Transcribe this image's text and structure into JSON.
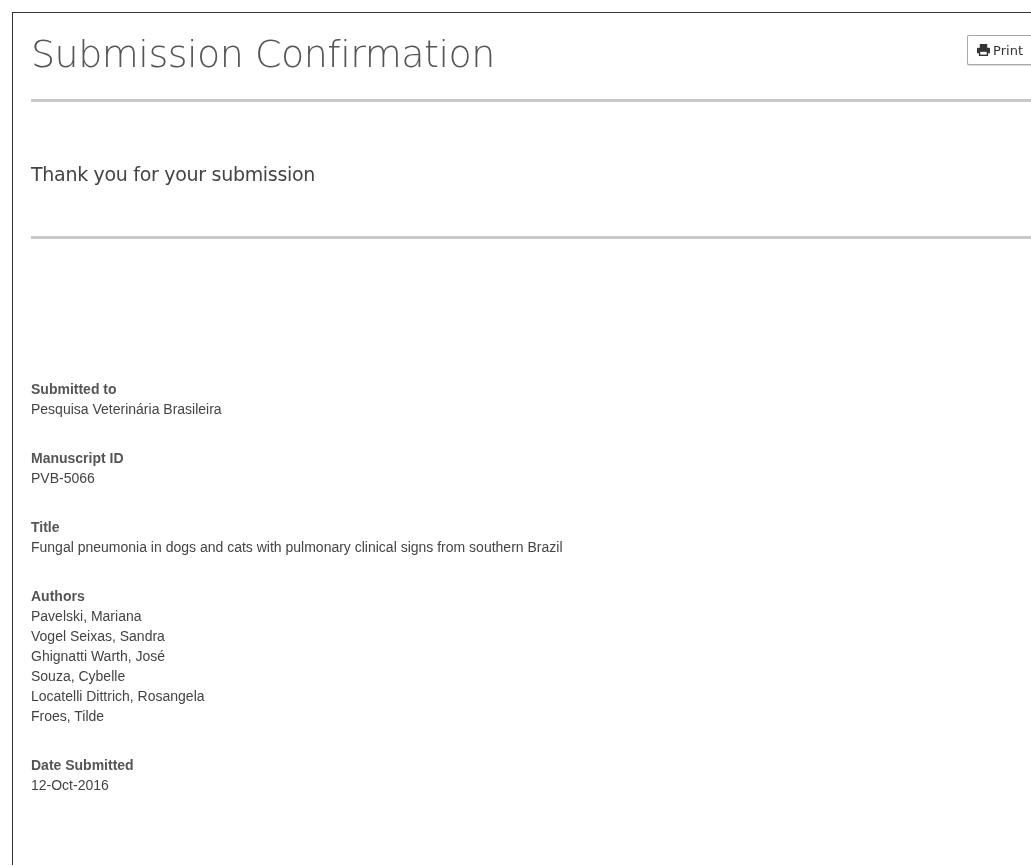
{
  "header": {
    "title": "Submission Confirmation",
    "print_button": "Print"
  },
  "message": "Thank you for your submission",
  "fields": [
    {
      "label": "Submitted to",
      "values": [
        "Pesquisa Veterinária Brasileira"
      ]
    },
    {
      "label": "Manuscript ID",
      "values": [
        "PVB-5066"
      ]
    },
    {
      "label": "Title",
      "values": [
        "Fungal pneumonia in dogs and cats with pulmonary clinical signs from southern Brazil"
      ]
    },
    {
      "label": "Authors",
      "values": [
        "Pavelski, Mariana",
        "Vogel Seixas, Sandra",
        "Ghignatti Warth, José",
        "Souza, Cybelle",
        "Locatelli Dittrich, Rosangela",
        "Froes, Tilde"
      ]
    },
    {
      "label": "Date Submitted",
      "values": [
        "12-Oct-2016"
      ]
    }
  ]
}
